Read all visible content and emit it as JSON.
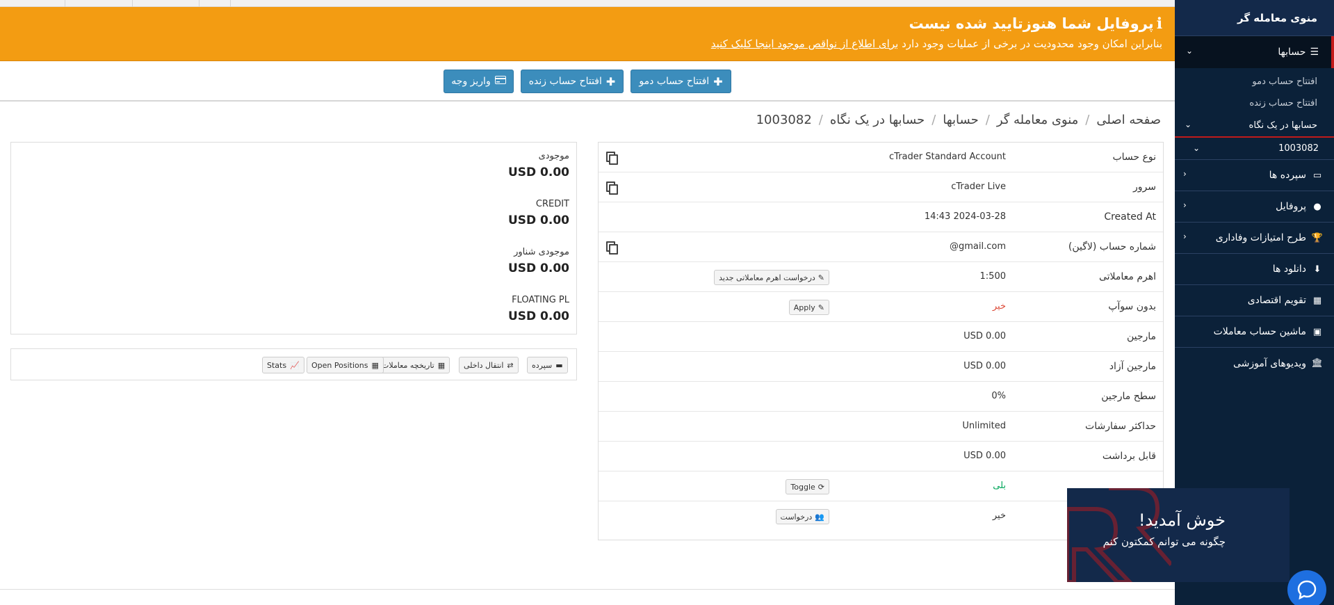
{
  "sidebar": {
    "title": "منوی معامله گر",
    "accounts_label": "حسابها",
    "sub_items": [
      "افتتاح حساب دمو",
      "افتتاح حساب زنده"
    ],
    "glance_label": "حسابها در یک نگاه",
    "account_number": "1003082",
    "items": [
      {
        "label": "سپرده ها",
        "icon": "wallet-icon"
      },
      {
        "label": "پروفایل",
        "icon": "user-icon"
      },
      {
        "label": "طرح امتیازات وفاداری",
        "icon": "trophy-icon"
      },
      {
        "label": "دانلود ها",
        "icon": "download-icon"
      },
      {
        "label": "تقویم اقتصادی",
        "icon": "calendar-icon"
      },
      {
        "label": "ماشین حساب معاملات",
        "icon": "calculator-icon"
      },
      {
        "label": "ویدیوهای آموزشی",
        "icon": "bank-icon"
      }
    ]
  },
  "banner": {
    "title": "پروفایل شما هنوزتایید شده نیست",
    "text": "بنابراین امکان وجود محدودیت در برخی از عملیات وجود دارد",
    "link": "برای اطلاع از نواقص موجود اینجا کلیک کنید",
    "color": "#f39c12"
  },
  "actions": {
    "demo": "افتتاح حساب دمو",
    "live": "افتتاح حساب زنده",
    "deposit": "واریز وجه"
  },
  "breadcrumb": [
    "صفحه اصلی",
    "منوی معامله گر",
    "حسابها",
    "حسابها در یک نگاه",
    "1003082"
  ],
  "details": {
    "rows": [
      {
        "label": "نوع حساب",
        "value": "cTrader Standard Account"
      },
      {
        "label": "سرور",
        "value": "cTrader Live"
      },
      {
        "label": "Created At",
        "value": "14:43 2024-03-28"
      },
      {
        "label": "شماره حساب (لاگین)",
        "value": "@gmail.com"
      },
      {
        "label": "اهرم معاملاتی",
        "value": "1:500"
      },
      {
        "label": "بدون سوآپ",
        "value": "خیر"
      },
      {
        "label": "مارجین",
        "value": "USD 0.00"
      },
      {
        "label": "مارجین آزاد",
        "value": "USD 0.00"
      },
      {
        "label": "سطح مارجین",
        "value": "0%"
      },
      {
        "label": "حداکثر سفارشات",
        "value": "Unlimited"
      },
      {
        "label": "قابل برداشت",
        "value": "USD 0.00"
      },
      {
        "label": "",
        "value": "بلی"
      },
      {
        "label": "",
        "value": "خیر"
      }
    ],
    "leverage_button": "درخواست اهرم معاملاتی جدید",
    "apply_button": "Apply",
    "toggle_button": "Toggle",
    "request_button": "درخواست"
  },
  "balances": [
    {
      "label": "موجودی",
      "value": "USD 0.00"
    },
    {
      "label": "CREDIT",
      "value": "USD 0.00"
    },
    {
      "label": "موجودی شناور",
      "value": "USD 0.00"
    },
    {
      "label": "FLOATING PL",
      "value": "USD 0.00"
    }
  ],
  "tabs": {
    "deposit": "سپرده",
    "transfer": "انتقال داخلی",
    "history": "تاریخچه معاملات",
    "open_positions": "Open Positions",
    "stats": "Stats"
  },
  "chat": {
    "title": "خوش آمدید!",
    "subtitle": "چگونه می توانم کمکتون کنم"
  }
}
